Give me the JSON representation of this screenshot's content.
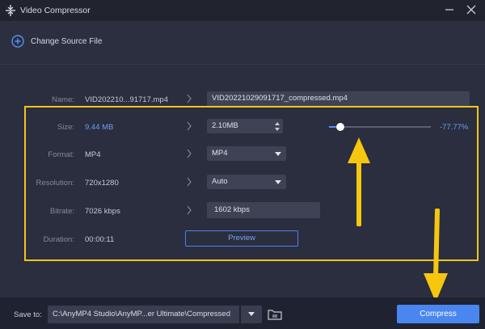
{
  "window": {
    "title": "Video Compressor",
    "icons": {
      "app": "compress-arrows-icon",
      "minimize": "minimize-icon",
      "close": "close-icon"
    }
  },
  "toolbar": {
    "change_source_label": "Change Source File",
    "icon": "plus-circle-icon"
  },
  "fields": {
    "name": {
      "label": "Name:",
      "source": "VID202210...91717.mp4",
      "output": "VID20221029091717_compressed.mp4"
    },
    "size": {
      "label": "Size:",
      "source": "9.44 MB",
      "output": "2.10MB",
      "slider_percent": "-77.77%",
      "slider_fraction": 0.11
    },
    "format": {
      "label": "Format:",
      "source": "MP4",
      "selected": "MP4"
    },
    "resolution": {
      "label": "Resolution:",
      "source": "720x1280",
      "selected": "Auto"
    },
    "bitrate": {
      "label": "Bitrate:",
      "source": "7026 kbps",
      "output": "1602 kbps"
    },
    "duration": {
      "label": "Duration:",
      "source": "00:00:11"
    }
  },
  "preview_label": "Preview",
  "save": {
    "label": "Save to:",
    "path": "C:\\AnyMP4 Studio\\AnyMP...er Ultimate\\Compressed",
    "folder_icon": "folder-icon"
  },
  "compress_label": "Compress",
  "colors": {
    "accent": "#4a86f0",
    "highlight": "#f5c518",
    "arrow": "#f7c60f"
  }
}
